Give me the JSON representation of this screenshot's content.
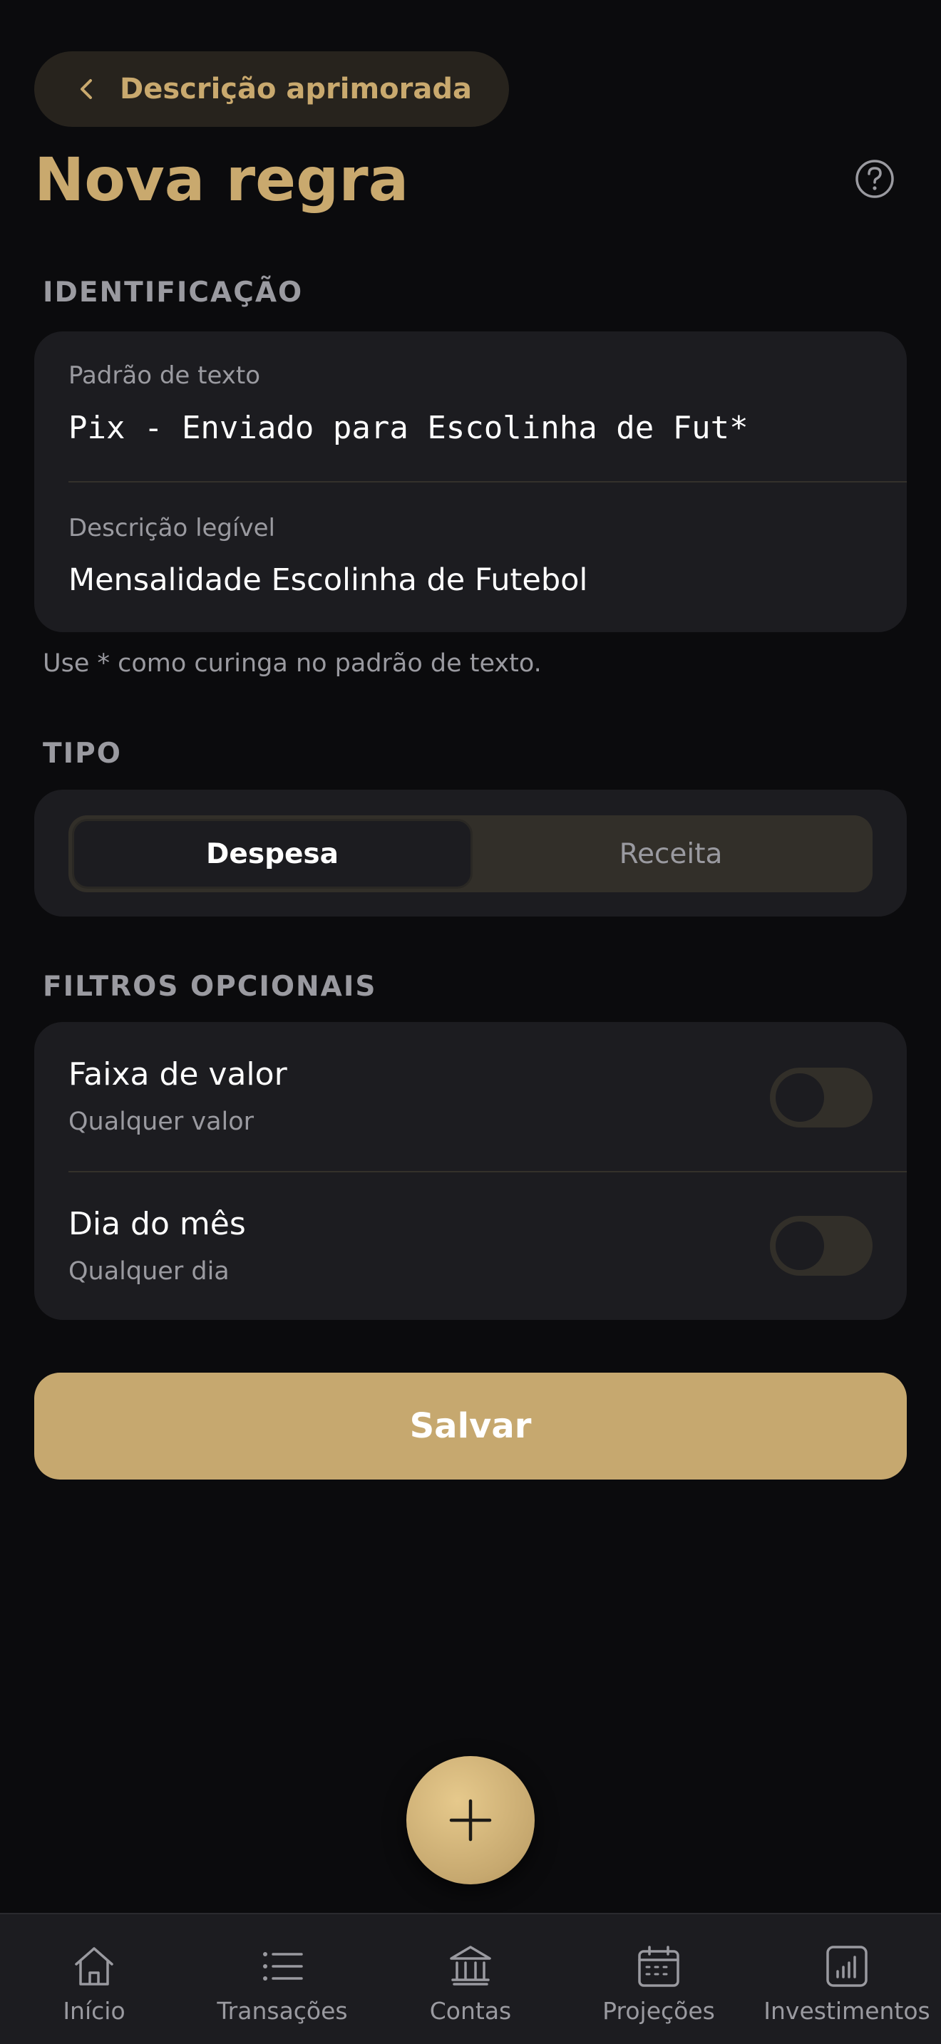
{
  "header": {
    "back_label": "Descrição aprimorada",
    "title": "Nova regra"
  },
  "identification": {
    "section_label": "IDENTIFICAÇÃO",
    "pattern_label": "Padrão de texto",
    "pattern_value": "Pix - Enviado para Escolinha de Fut*",
    "description_label": "Descrição legível",
    "description_value": "Mensalidade Escolinha de Futebol",
    "hint": "Use * como curinga no padrão de texto."
  },
  "type": {
    "section_label": "TIPO",
    "options": [
      "Despesa",
      "Receita"
    ],
    "selected": "Despesa"
  },
  "filters": {
    "section_label": "FILTROS OPCIONAIS",
    "items": [
      {
        "title": "Faixa de valor",
        "subtitle": "Qualquer valor",
        "enabled": false
      },
      {
        "title": "Dia do mês",
        "subtitle": "Qualquer dia",
        "enabled": false
      }
    ]
  },
  "actions": {
    "save_label": "Salvar"
  },
  "tabbar": {
    "items": [
      {
        "label": "Início",
        "icon": "home-icon"
      },
      {
        "label": "Transações",
        "icon": "list-icon"
      },
      {
        "label": "Contas",
        "icon": "bank-icon"
      },
      {
        "label": "Projeções",
        "icon": "calendar-icon"
      },
      {
        "label": "Investimentos",
        "icon": "chart-icon"
      }
    ]
  },
  "colors": {
    "background": "#0b0b0d",
    "card": "#1c1c20",
    "accent": "#c9a96e",
    "muted_text": "#9a9aa0"
  }
}
